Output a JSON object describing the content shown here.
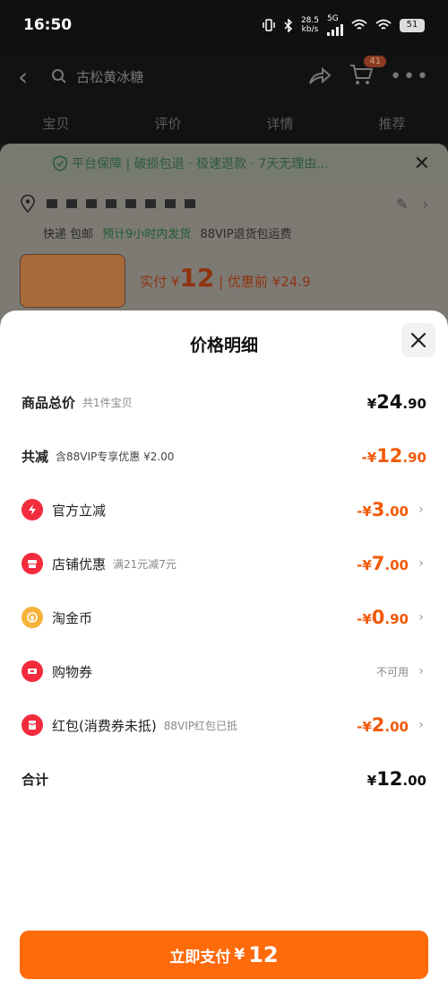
{
  "status_bar": {
    "time": "16:50",
    "speed_value": "28.5",
    "speed_unit": "kb/s",
    "network": "5G",
    "battery": "51"
  },
  "nav": {
    "search_text": "古松黄冰糖",
    "cart_count": "41"
  },
  "tabs": [
    "宝贝",
    "评价",
    "详情",
    "推荐"
  ],
  "bg_sheet": {
    "guarantee": "平台保障 | 破损包退 · 极速退款 · 7天无理由...",
    "shipping": "快递 包邮",
    "ship_time": "预计9小时内发货",
    "vip_note": "88VIP退货包运费",
    "paid_label": "实付",
    "paid_currency": "¥",
    "paid_amount": "12",
    "before_label": "| 优惠前 ¥24.9"
  },
  "sheet": {
    "title": "价格明细",
    "rows": [
      {
        "label": "商品总价",
        "sub": "共1件宝贝",
        "sym": "¥",
        "int": "24",
        "dec": ".90"
      },
      {
        "label": "共减",
        "sub": "含88VIP专享优惠 ¥2.00",
        "sym": "-¥",
        "int": "12",
        "dec": ".90"
      },
      {
        "label": "官方立减",
        "icon": "lightning-icon",
        "sym": "-¥",
        "int": "3",
        "dec": ".00"
      },
      {
        "label": "店铺优惠",
        "sub": "满21元减7元",
        "icon": "shop-icon",
        "sym": "-¥",
        "int": "7",
        "dec": ".00"
      },
      {
        "label": "淘金币",
        "icon": "coin-icon",
        "sym": "-¥",
        "int": "0",
        "dec": ".90"
      },
      {
        "label": "购物券",
        "icon": "coupon-icon",
        "status": "不可用"
      },
      {
        "label": "红包(消费券未抵)",
        "sub": "88VIP红包已抵",
        "icon": "red-packet-icon",
        "sym": "-¥",
        "int": "2",
        "dec": ".00"
      },
      {
        "label": "合计",
        "sym": "¥",
        "int": "12",
        "dec": ".00"
      }
    ]
  },
  "pay_button": {
    "label": "立即支付",
    "currency": "¥",
    "amount": "12"
  },
  "colors": {
    "accent": "#ff6a0a",
    "discount": "#f15a0a",
    "icon_red": "#f22c3d",
    "coin": "#f6b23a"
  }
}
